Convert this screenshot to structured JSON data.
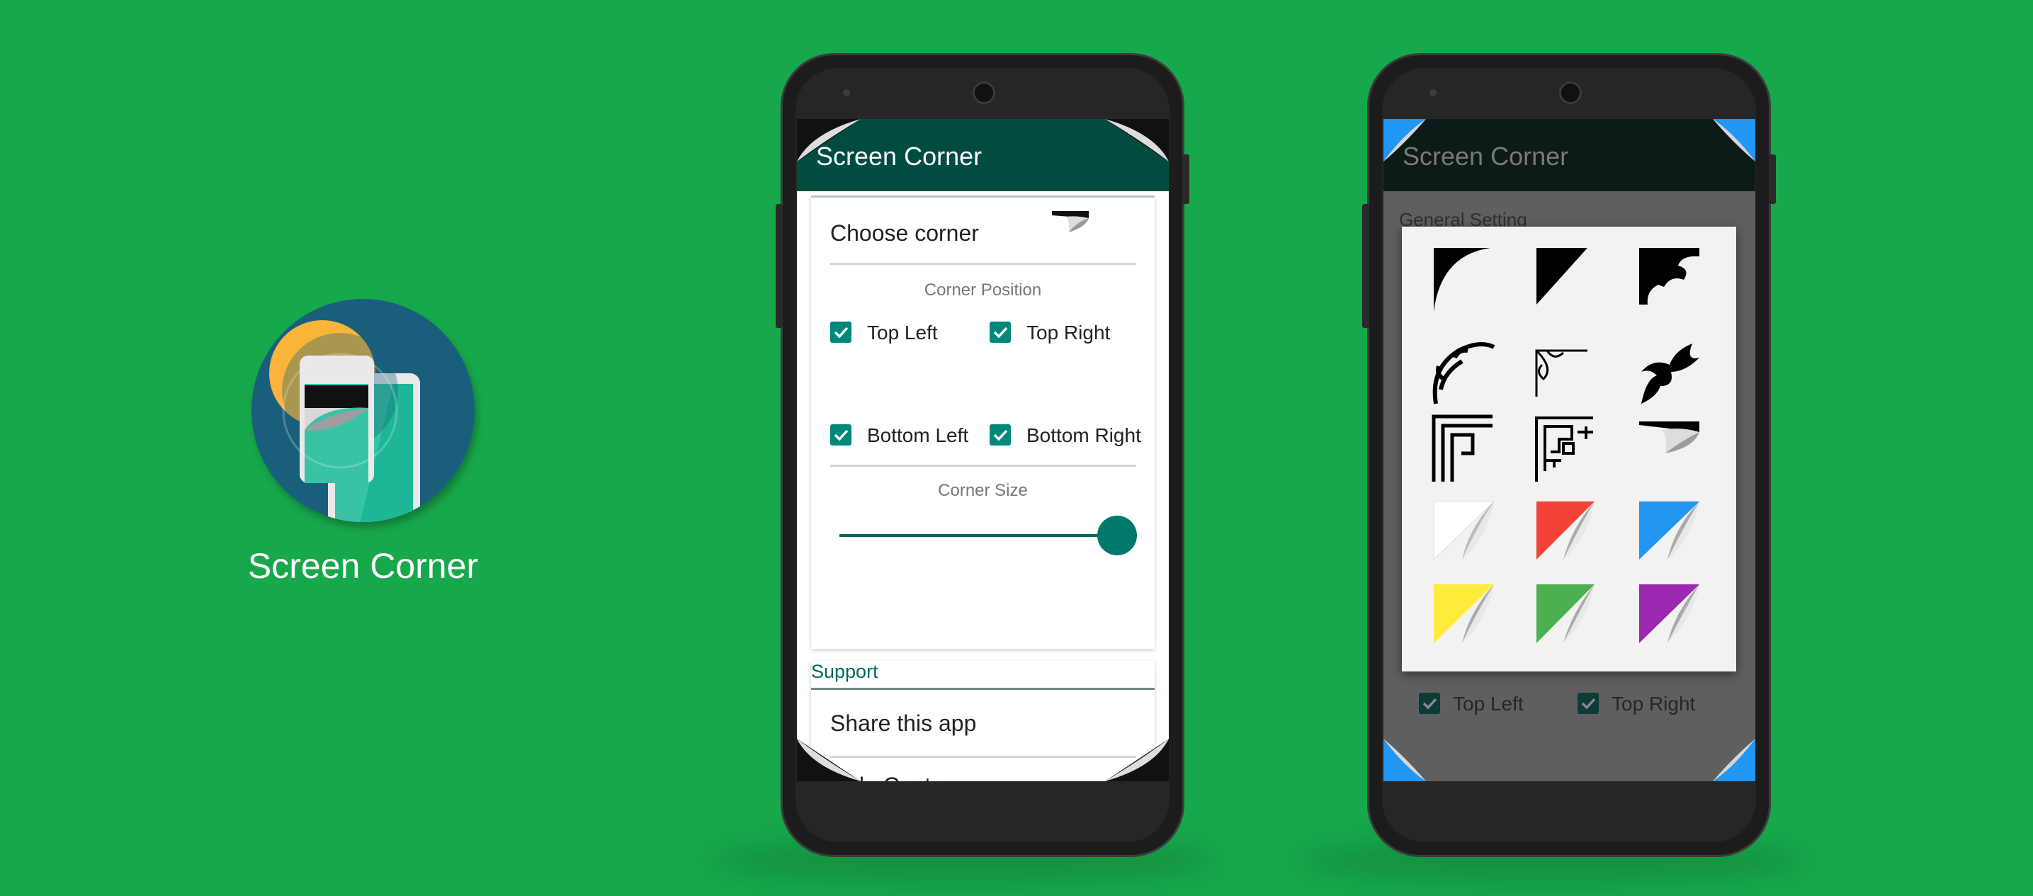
{
  "app": {
    "name": "Screen Corner"
  },
  "phone1": {
    "appbar_title": "Screen Corner",
    "choose_corner_label": "Choose corner",
    "corner_position_caption": "Corner Position",
    "checkboxes": [
      {
        "label": "Top Left",
        "checked": true
      },
      {
        "label": "Top Right",
        "checked": true
      },
      {
        "label": "Bottom Left",
        "checked": true
      },
      {
        "label": "Bottom Right",
        "checked": true
      }
    ],
    "corner_size_caption": "Corner Size",
    "corner_size_value": 1.0,
    "support_header": "Support",
    "share_label": "Share this app",
    "help_label": "Help Center"
  },
  "phone2": {
    "appbar_title": "Screen Corner",
    "general_setting_header": "General Setting",
    "corner_styles": [
      "quarter-circle-corner",
      "triangle-corner",
      "ornate-black-corner",
      "vine-ornament-corner",
      "swirl-thin-corner",
      "floral-black-corner",
      "greek-key-corner",
      "maze-corner",
      "page-curl-black-corner",
      "page-curl-white-corner",
      "page-curl-red-corner",
      "page-curl-blue-corner",
      "page-curl-yellow-corner",
      "page-curl-green-corner",
      "page-curl-purple-corner"
    ],
    "checkboxes": [
      {
        "label": "Top Left",
        "checked": true
      },
      {
        "label": "Top Right",
        "checked": true
      }
    ]
  },
  "colors": {
    "background": "#17a84b",
    "appbar": "#004d40",
    "accent": "#00897b",
    "corner_blue": "#2196f3",
    "curl_red": "#f44336",
    "curl_blue": "#2196f3",
    "curl_yellow": "#ffeb3b",
    "curl_green": "#4caf50",
    "curl_purple": "#9c27b0"
  }
}
